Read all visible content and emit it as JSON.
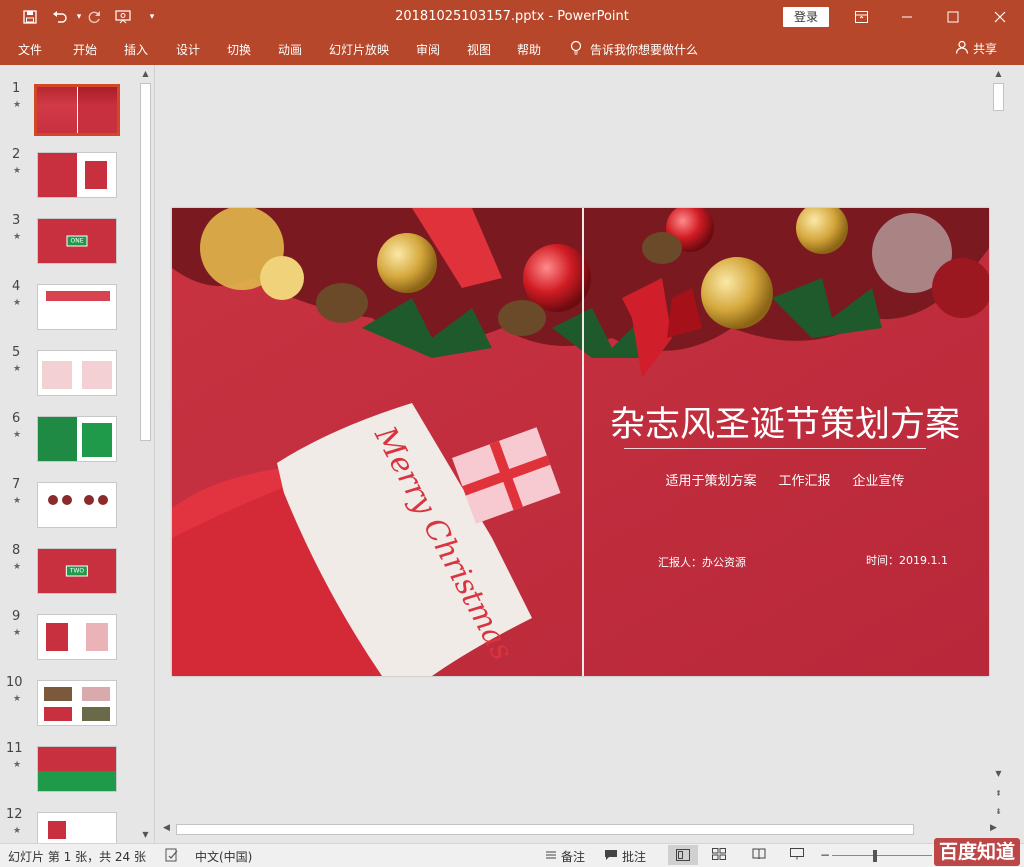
{
  "window": {
    "title": "20181025103157.pptx  -  PowerPoint",
    "login_label": "登录"
  },
  "ribbon": {
    "tabs": [
      "文件",
      "开始",
      "插入",
      "设计",
      "切换",
      "动画",
      "幻灯片放映",
      "审阅",
      "视图",
      "帮助"
    ],
    "tell_me": "告诉我你想要做什么",
    "share": "共享"
  },
  "thumbnails": {
    "numbers": [
      "1",
      "2",
      "3",
      "4",
      "5",
      "6",
      "7",
      "8",
      "9",
      "10",
      "11",
      "12"
    ],
    "tags": {
      "3": "ONE",
      "8": "TWO"
    }
  },
  "slide": {
    "title": "杂志风圣诞节策划方案",
    "subtitles": [
      "适用于策划方案",
      "工作汇报",
      "企业宣传"
    ],
    "reporter": "汇报人：办公资源",
    "date": "时间：2019.1.1",
    "stocking_text": "Merry Christmas"
  },
  "status": {
    "slide_info": "幻灯片 第 1 张，共 24 张",
    "language": "中文(中国)",
    "notes": "备注",
    "comments": "批注"
  },
  "watermark": "百度知道",
  "colors": {
    "accent": "#b7472a",
    "slide_bg": "#c8303f",
    "active_border": "#d24726",
    "section_tag": "#1e9a4a"
  }
}
